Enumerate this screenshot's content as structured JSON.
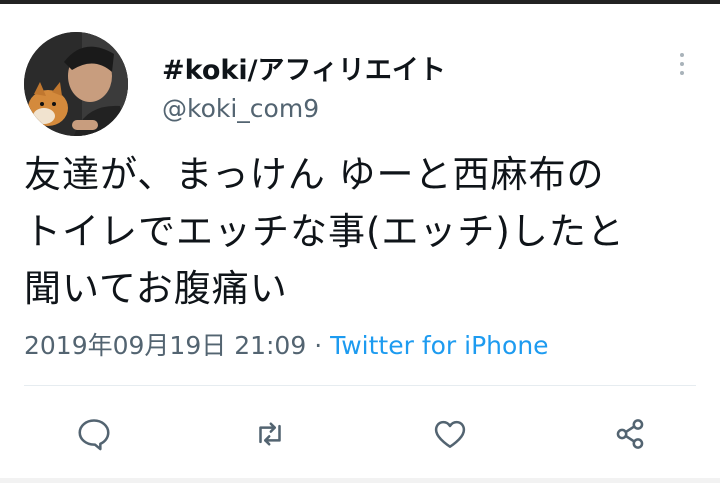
{
  "author": {
    "display_name": "#koki/アフィリエイト",
    "handle": "@koki_com9"
  },
  "tweet": {
    "lines": [
      "友達が、まっけん ゆーと西麻布の",
      "トイレでエッチな事(エッチ)したと",
      "聞いてお腹痛い"
    ],
    "timestamp": "2019年09月19日 21:09",
    "separator": " · ",
    "source": "Twitter for iPhone"
  },
  "colors": {
    "text": "#0f1419",
    "secondary": "#536471",
    "link": "#1d9bf0",
    "icon": "#536471"
  },
  "icons": [
    "reply-icon",
    "retweet-icon",
    "like-icon",
    "share-icon",
    "more-icon"
  ]
}
